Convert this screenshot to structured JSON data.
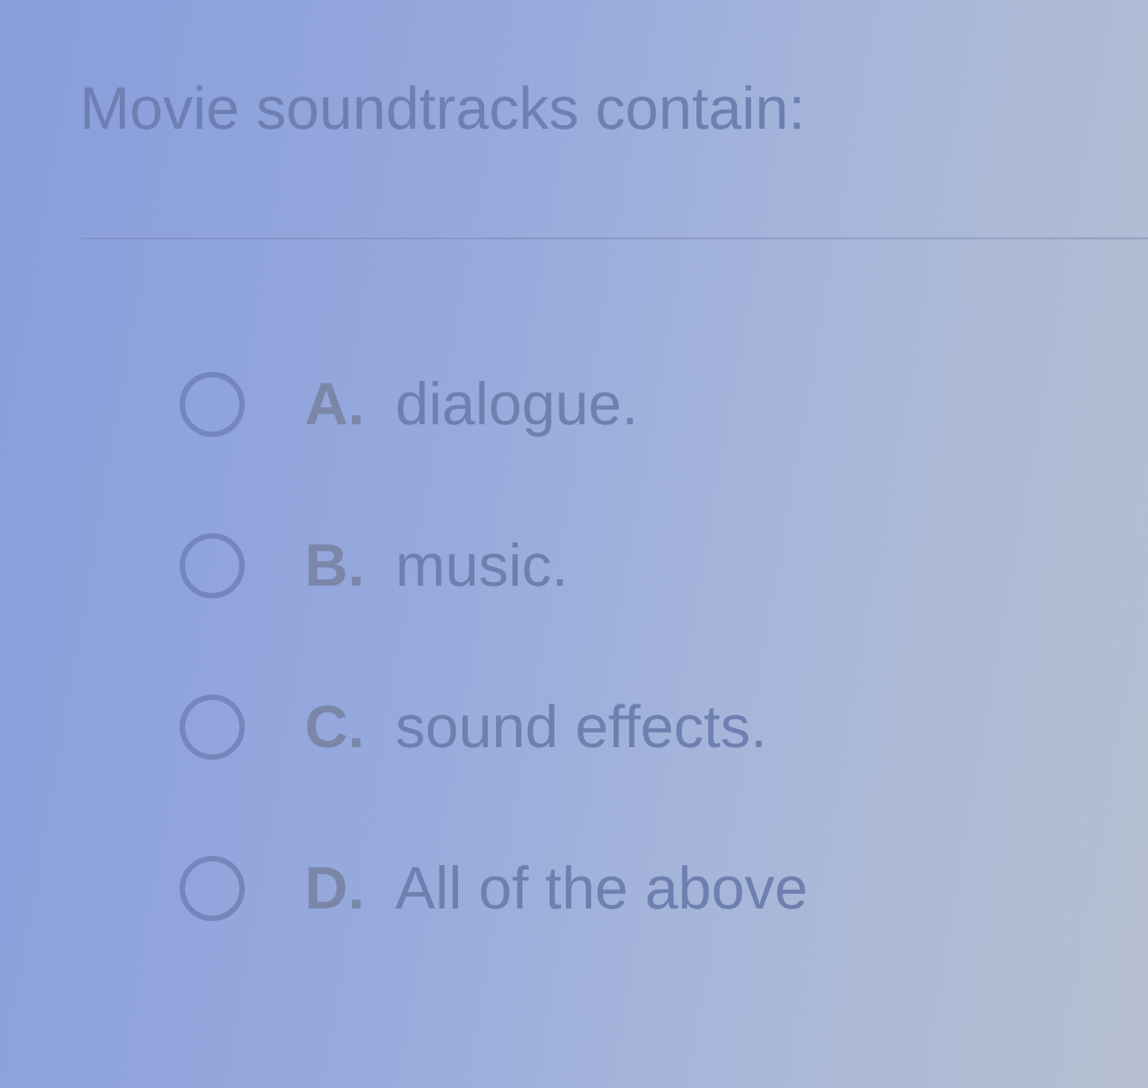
{
  "question": {
    "text": "Movie soundtracks contain:"
  },
  "options": [
    {
      "letter": "A.",
      "text": "dialogue.",
      "selected": false
    },
    {
      "letter": "B.",
      "text": "music.",
      "selected": false
    },
    {
      "letter": "C.",
      "text": "sound effects.",
      "selected": false
    },
    {
      "letter": "D.",
      "text": "All of the above",
      "selected": false
    }
  ]
}
